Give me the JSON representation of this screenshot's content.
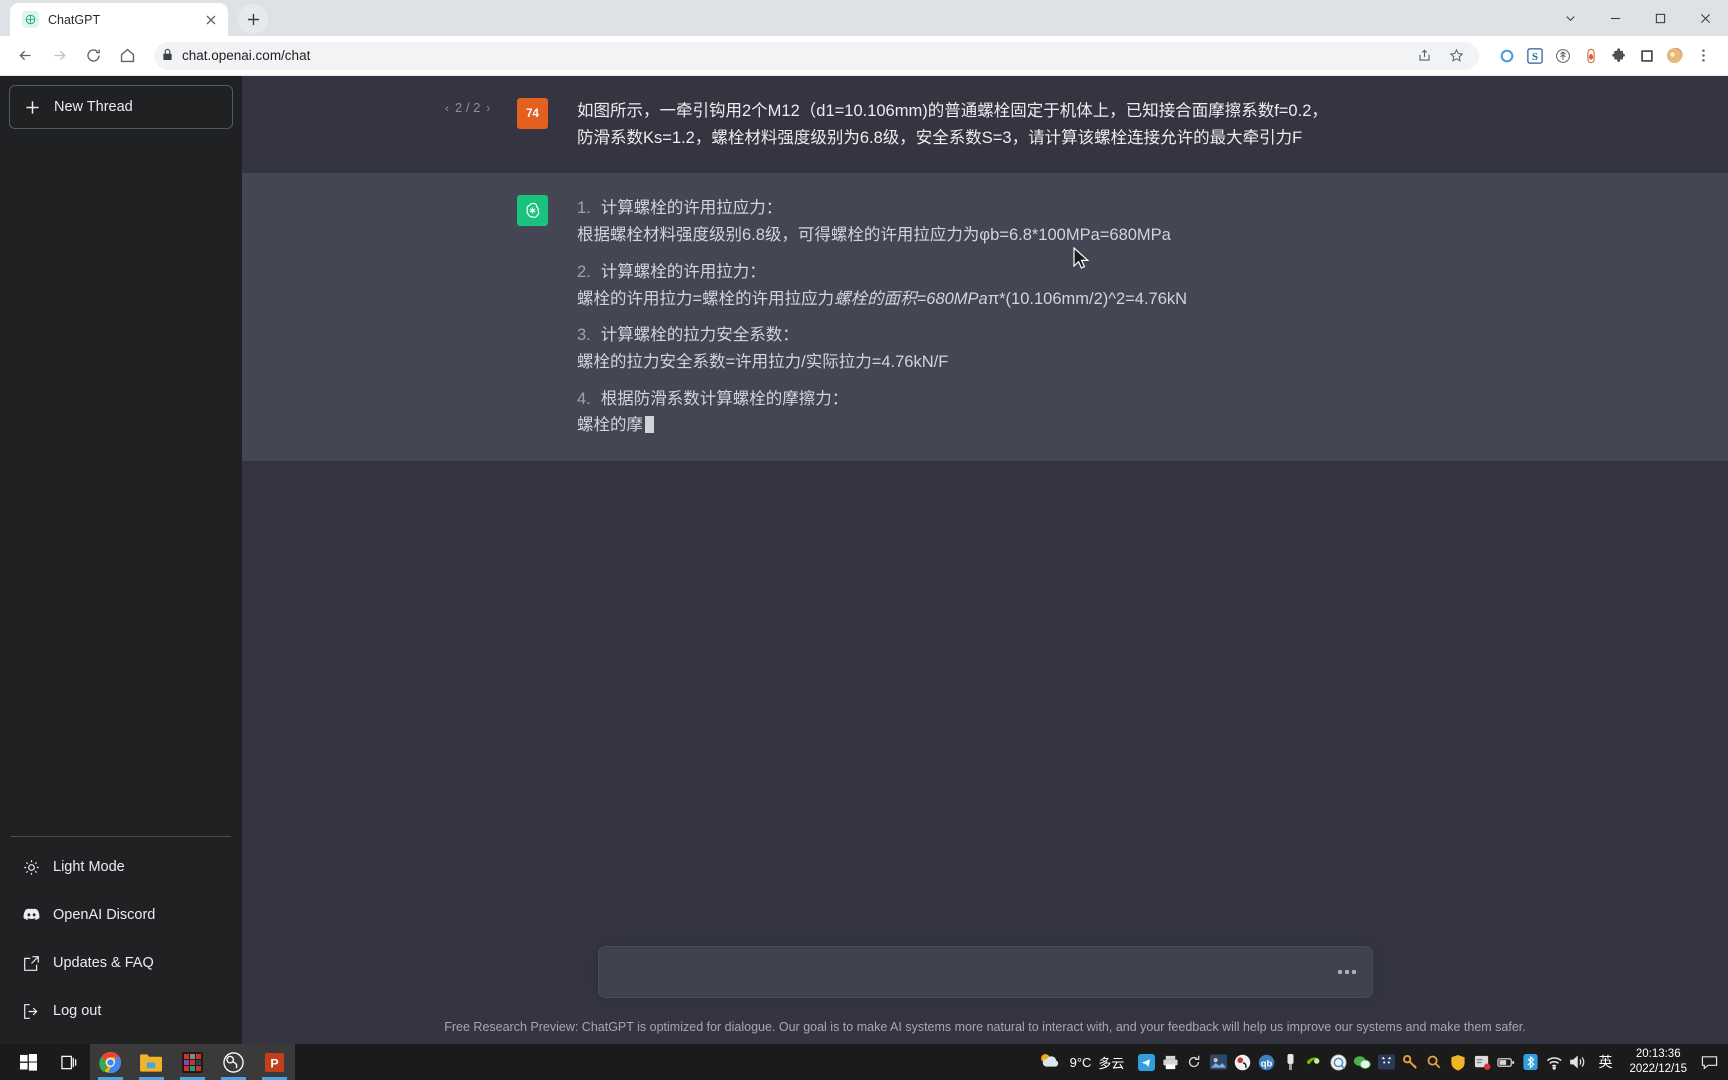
{
  "browser": {
    "tab": {
      "title": "ChatGPT",
      "favicon_icon": "openai-logo-icon",
      "close_icon": "close-icon"
    },
    "new_tab_icon": "plus-icon",
    "window_controls": {
      "restore_down_icon": "chevron-down-icon",
      "minimize_icon": "minimize-icon",
      "maximize_icon": "maximize-icon",
      "close_icon": "close-icon"
    },
    "nav": {
      "back_icon": "back-arrow-icon",
      "forward_icon": "forward-arrow-icon",
      "reload_icon": "reload-icon",
      "home_icon": "home-icon"
    },
    "omnibox": {
      "lock_icon": "lock-icon",
      "url": "chat.openai.com/chat",
      "share_icon": "share-icon",
      "bookmark_icon": "star-icon"
    },
    "extensions": [
      "circle-blue-icon",
      "sogou-s-icon",
      "tree-badge-icon",
      "capsule-icon",
      "puzzle-extensions-icon",
      "square-icon",
      "profile-avatar-icon"
    ],
    "menu_icon": "three-dot-menu-icon"
  },
  "sidebar": {
    "new_thread": {
      "label": "New Thread",
      "icon": "plus-icon"
    },
    "items": [
      {
        "label": "Light Mode",
        "icon": "sun-icon"
      },
      {
        "label": "OpenAI Discord",
        "icon": "discord-icon"
      },
      {
        "label": "Updates & FAQ",
        "icon": "external-link-icon"
      },
      {
        "label": "Log out",
        "icon": "logout-icon"
      }
    ]
  },
  "conversation": {
    "pager": {
      "prev_icon": "chevron-left-icon",
      "next_icon": "chevron-right-icon",
      "label": "2 / 2"
    },
    "user": {
      "avatar_label": "74",
      "avatar_color": "#e4601f",
      "text": "如图所示，一牵引钩用2个M12（d1=10.106mm)的普通螺栓固定于机体上，已知接合面摩擦系数f=0.2，防滑系数Ks=1.2，螺栓材料强度级别为6.8级，安全系数S=3，请计算该螺栓连接允许的最大牵引力F"
    },
    "assistant": {
      "avatar_icon": "openai-logo-icon",
      "avatar_color": "#19c37d",
      "blocks": [
        {
          "kind": "item",
          "num": "1.",
          "text": "计算螺栓的许用拉应力："
        },
        {
          "kind": "para",
          "text": "根据螺栓材料强度级别6.8级，可得螺栓的许用拉应力为φb=6.8*100MPa=680MPa"
        },
        {
          "kind": "item",
          "num": "2.",
          "text": "计算螺栓的许用拉力："
        },
        {
          "kind": "para_mixed",
          "text_a": "螺栓的许用拉力=螺栓的许用拉应力",
          "text_i": "螺栓的面积=680MPa",
          "text_b": "π*(10.106mm/2)^2=4.76kN"
        },
        {
          "kind": "item",
          "num": "3.",
          "text": "计算螺栓的拉力安全系数："
        },
        {
          "kind": "para",
          "text": "螺栓的拉力安全系数=许用拉力/实际拉力=4.76kN/F"
        },
        {
          "kind": "item",
          "num": "4.",
          "text": "根据防滑系数计算螺栓的摩擦力："
        },
        {
          "kind": "streaming",
          "text": "螺栓的摩"
        }
      ]
    }
  },
  "composer": {
    "value": "",
    "placeholder": "",
    "loading_icon": "three-dots-loading-icon"
  },
  "footer": {
    "disclaimer": "Free Research Preview: ChatGPT is optimized for dialogue. Our goal is to make AI systems more natural to interact with, and your feedback will help us improve our systems and make them safer."
  },
  "taskbar": {
    "start_icon": "windows-start-icon",
    "taskview_icon": "task-view-icon",
    "pinned": [
      {
        "name": "chrome-icon",
        "active": true
      },
      {
        "name": "file-explorer-icon",
        "active": true
      },
      {
        "name": "app-grid-icon",
        "active": true
      },
      {
        "name": "obs-icon",
        "active": true
      },
      {
        "name": "powerpoint-icon",
        "active": true
      }
    ],
    "weather": {
      "icon": "cloudy-sun-icon",
      "temperature": "9°C",
      "condition": "多云"
    },
    "tray": [
      "telegram-icon",
      "printer-icon",
      "sync-icon",
      "picture-icon",
      "obs-tray-icon",
      "qbittorrent-icon",
      "usb-icon",
      "nvidia-icon",
      "qq-icon",
      "wechat-icon",
      "cat-icon",
      "key-icon",
      "search-tray-icon",
      "shield-icon",
      "screenshot-icon",
      "battery-icon",
      "bluetooth-icon"
    ],
    "network_icon": "wifi-icon",
    "volume_icon": "speaker-icon",
    "ime": "英",
    "clock": {
      "time": "20:13:36",
      "date": "2022/12/15"
    },
    "notification_icon": "notification-icon"
  }
}
